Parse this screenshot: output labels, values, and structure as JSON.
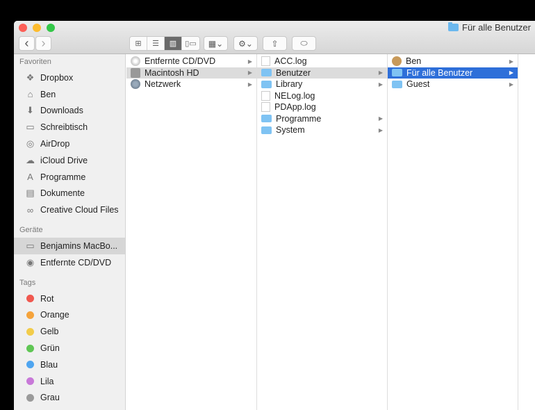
{
  "window": {
    "title": "Für alle Benutzer"
  },
  "toolbar": {
    "back": "‹",
    "forward": "›",
    "views": [
      "icon-view",
      "list-view",
      "column-view",
      "coverflow-view"
    ],
    "arrange": "▦⌄",
    "action": "⚙⌄",
    "share": "⇧",
    "tags": "⬭"
  },
  "sidebar": {
    "favorites_header": "Favoriten",
    "favorites": [
      {
        "label": "Dropbox",
        "icon": "❖"
      },
      {
        "label": "Ben",
        "icon": "⌂"
      },
      {
        "label": "Downloads",
        "icon": "⬇"
      },
      {
        "label": "Schreibtisch",
        "icon": "▭"
      },
      {
        "label": "AirDrop",
        "icon": "◎"
      },
      {
        "label": "iCloud Drive",
        "icon": "☁"
      },
      {
        "label": "Programme",
        "icon": "A"
      },
      {
        "label": "Dokumente",
        "icon": "▤"
      },
      {
        "label": "Creative Cloud Files",
        "icon": "∞"
      }
    ],
    "devices_header": "Geräte",
    "devices": [
      {
        "label": "Benjamins MacBo...",
        "icon": "▭"
      },
      {
        "label": "Entfernte CD/DVD",
        "icon": "◉"
      }
    ],
    "tags_header": "Tags",
    "tags": [
      {
        "label": "Rot",
        "color": "#f0584f"
      },
      {
        "label": "Orange",
        "color": "#f5a33b"
      },
      {
        "label": "Gelb",
        "color": "#f2cc4a"
      },
      {
        "label": "Grün",
        "color": "#5fc654"
      },
      {
        "label": "Blau",
        "color": "#4fa5f0"
      },
      {
        "label": "Lila",
        "color": "#c879d8"
      },
      {
        "label": "Grau",
        "color": "#9a9a9a"
      }
    ]
  },
  "columns": [
    [
      {
        "label": "Entfernte CD/DVD",
        "type": "cd",
        "arrow": true
      },
      {
        "label": "Macintosh HD",
        "type": "hd",
        "arrow": true,
        "state": "gray"
      },
      {
        "label": "Netzwerk",
        "type": "net",
        "arrow": true
      }
    ],
    [
      {
        "label": "ACC.log",
        "type": "file"
      },
      {
        "label": "Benutzer",
        "type": "folder",
        "arrow": true,
        "state": "gray"
      },
      {
        "label": "Library",
        "type": "folder",
        "arrow": true
      },
      {
        "label": "NELog.log",
        "type": "file"
      },
      {
        "label": "PDApp.log",
        "type": "file"
      },
      {
        "label": "Programme",
        "type": "folder",
        "arrow": true
      },
      {
        "label": "System",
        "type": "folder",
        "arrow": true
      }
    ],
    [
      {
        "label": "Ben",
        "type": "home",
        "arrow": true
      },
      {
        "label": "Für alle Benutzer",
        "type": "folder",
        "arrow": true,
        "state": "blue"
      },
      {
        "label": "Guest",
        "type": "folder",
        "arrow": true
      }
    ]
  ]
}
